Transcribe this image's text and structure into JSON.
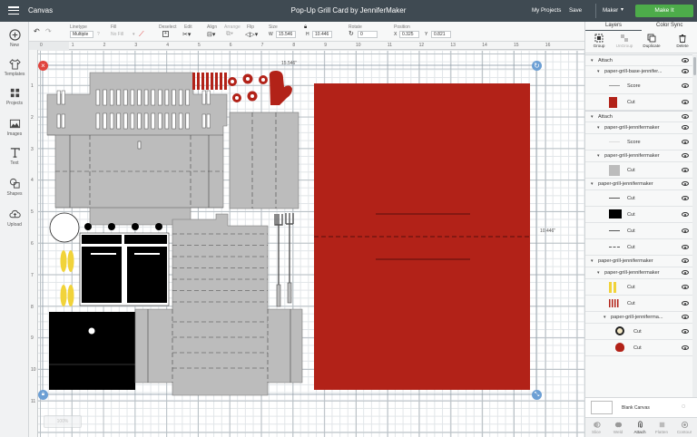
{
  "topbar": {
    "app_name": "Canvas",
    "project_title": "Pop-Up Grill Card by JenniferMaker",
    "my_projects": "My Projects",
    "save": "Save",
    "machine": "Maker",
    "make_it": "Make It"
  },
  "toolbar": {
    "linetype_label": "Linetype",
    "linetype_value": "Multiple",
    "fill_label": "Fill",
    "fill_value": "No Fill",
    "deselect": "Deselect",
    "edit": "Edit",
    "align": "Align",
    "arrange": "Arrange",
    "flip": "Flip",
    "size": "Size",
    "size_w_label": "W",
    "size_w": "15.546",
    "size_h_label": "H",
    "size_h": "10.446",
    "rotate": "Rotate",
    "rotate_value": "0",
    "position": "Position",
    "pos_x_label": "X",
    "pos_x": "0.325",
    "pos_y_label": "Y",
    "pos_y": "0.821"
  },
  "leftnav": [
    {
      "label": "New",
      "icon": "plus-circle-icon"
    },
    {
      "label": "Templates",
      "icon": "shirt-icon"
    },
    {
      "label": "Projects",
      "icon": "grid-icon"
    },
    {
      "label": "Images",
      "icon": "image-icon"
    },
    {
      "label": "Text",
      "icon": "text-icon"
    },
    {
      "label": "Shapes",
      "icon": "shapes-icon"
    },
    {
      "label": "Upload",
      "icon": "upload-cloud-icon"
    }
  ],
  "canvas": {
    "ruler_top": [
      "0",
      "1",
      "2",
      "3",
      "4",
      "5",
      "6",
      "7",
      "8",
      "9",
      "10",
      "11",
      "12",
      "13",
      "14",
      "15",
      "16"
    ],
    "ruler_left": [
      "1",
      "2",
      "3",
      "4",
      "5",
      "6",
      "7",
      "8",
      "9",
      "10",
      "11"
    ],
    "width_label": "15.546\"",
    "height_label": "10.446\"",
    "zoom_label": "100%",
    "accent_red": "#b22218",
    "gray": "#bcbcbc"
  },
  "panel": {
    "tab_layers": "Layers",
    "tab_color_sync": "Color Sync",
    "tools": [
      "Group",
      "UnGroup",
      "Duplicate",
      "Delete"
    ],
    "layers": [
      {
        "label": "Attach",
        "indent": 0,
        "kind": "header"
      },
      {
        "label": "paper-grill-base-jennifer...",
        "indent": 1,
        "kind": "group"
      },
      {
        "label": "Score",
        "indent": 2,
        "kind": "score"
      },
      {
        "label": "Cut",
        "indent": 2,
        "kind": "cut-red"
      },
      {
        "label": "Attach",
        "indent": 0,
        "kind": "header"
      },
      {
        "label": "paper-grill-jennifermaker",
        "indent": 1,
        "kind": "group"
      },
      {
        "label": "Score",
        "indent": 2,
        "kind": "score-light"
      },
      {
        "label": "paper-grill-jennifermaker",
        "indent": 1,
        "kind": "group"
      },
      {
        "label": "Cut",
        "indent": 2,
        "kind": "cut-gray"
      },
      {
        "label": "paper-grill-jennifermaker",
        "indent": 0,
        "kind": "group"
      },
      {
        "label": "Cut",
        "indent": 2,
        "kind": "line"
      },
      {
        "label": "Cut",
        "indent": 2,
        "kind": "cut-black"
      },
      {
        "label": "Cut",
        "indent": 2,
        "kind": "line"
      },
      {
        "label": "Cut",
        "indent": 2,
        "kind": "dash"
      },
      {
        "label": "paper-grill-jennifermaker",
        "indent": 0,
        "kind": "group"
      },
      {
        "label": "paper-grill-jennifermaker",
        "indent": 1,
        "kind": "group"
      },
      {
        "label": "Cut",
        "indent": 2,
        "kind": "cut-yellow"
      },
      {
        "label": "Cut",
        "indent": 2,
        "kind": "cut-redstripes"
      },
      {
        "label": "paper-grill-jennifermа...",
        "indent": 2,
        "kind": "group"
      },
      {
        "label": "Cut",
        "indent": 3,
        "kind": "cut-ring"
      },
      {
        "label": "Cut",
        "indent": 3,
        "kind": "cut-heart"
      }
    ],
    "blank_canvas": "Blank Canvas",
    "bottom_tools": [
      "Slice",
      "Weld",
      "Attach",
      "Flatten",
      "Contour"
    ]
  }
}
